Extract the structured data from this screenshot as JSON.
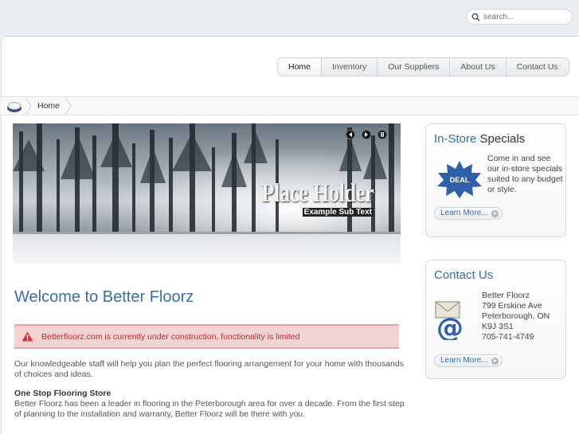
{
  "search": {
    "placeholder": "search..."
  },
  "nav": {
    "tabs": [
      "Home",
      "Inventory",
      "Our Suppliers",
      "About Us",
      "Contact Us"
    ],
    "active": "Home"
  },
  "breadcrumb": {
    "items": [
      "Home"
    ]
  },
  "slideshow": {
    "title": "Place Holder",
    "subtitle": "Example Sub Text"
  },
  "main": {
    "heading": "Welcome to Better Floorz",
    "warning": "Betterfloorz.com is currently under construction, functionality is limited",
    "intro": "Our knowledgeable staff will help you plan the perfect flooring arrangement for your home with thousands of choices and ideas.",
    "section_title": "One Stop Flooring Store",
    "section_text": "Better Floorz has been a leader in flooring in the Peterborough area for over a decade. From the first step of planning to the installation and warranty, Better Floorz will be there with you."
  },
  "specials": {
    "title_part1": "In-Store",
    "title_part2": "Specials",
    "badge": "DEAL",
    "text": "Come in and see our in-store specials suited to any budget or style.",
    "more": "Learn More..."
  },
  "contact": {
    "title_part1": "Contact",
    "title_part2": "Us",
    "name": "Better Floorz",
    "street": "799 Erskine Ave",
    "city": "Peterborough, ON",
    "postal": "K9J 3S1",
    "phone": "705-741-4749",
    "more": "Learn More..."
  },
  "colors": {
    "accent": "#3a6ea5",
    "warning_text": "#c0292e",
    "warning_bg": "#f3d2d3"
  }
}
